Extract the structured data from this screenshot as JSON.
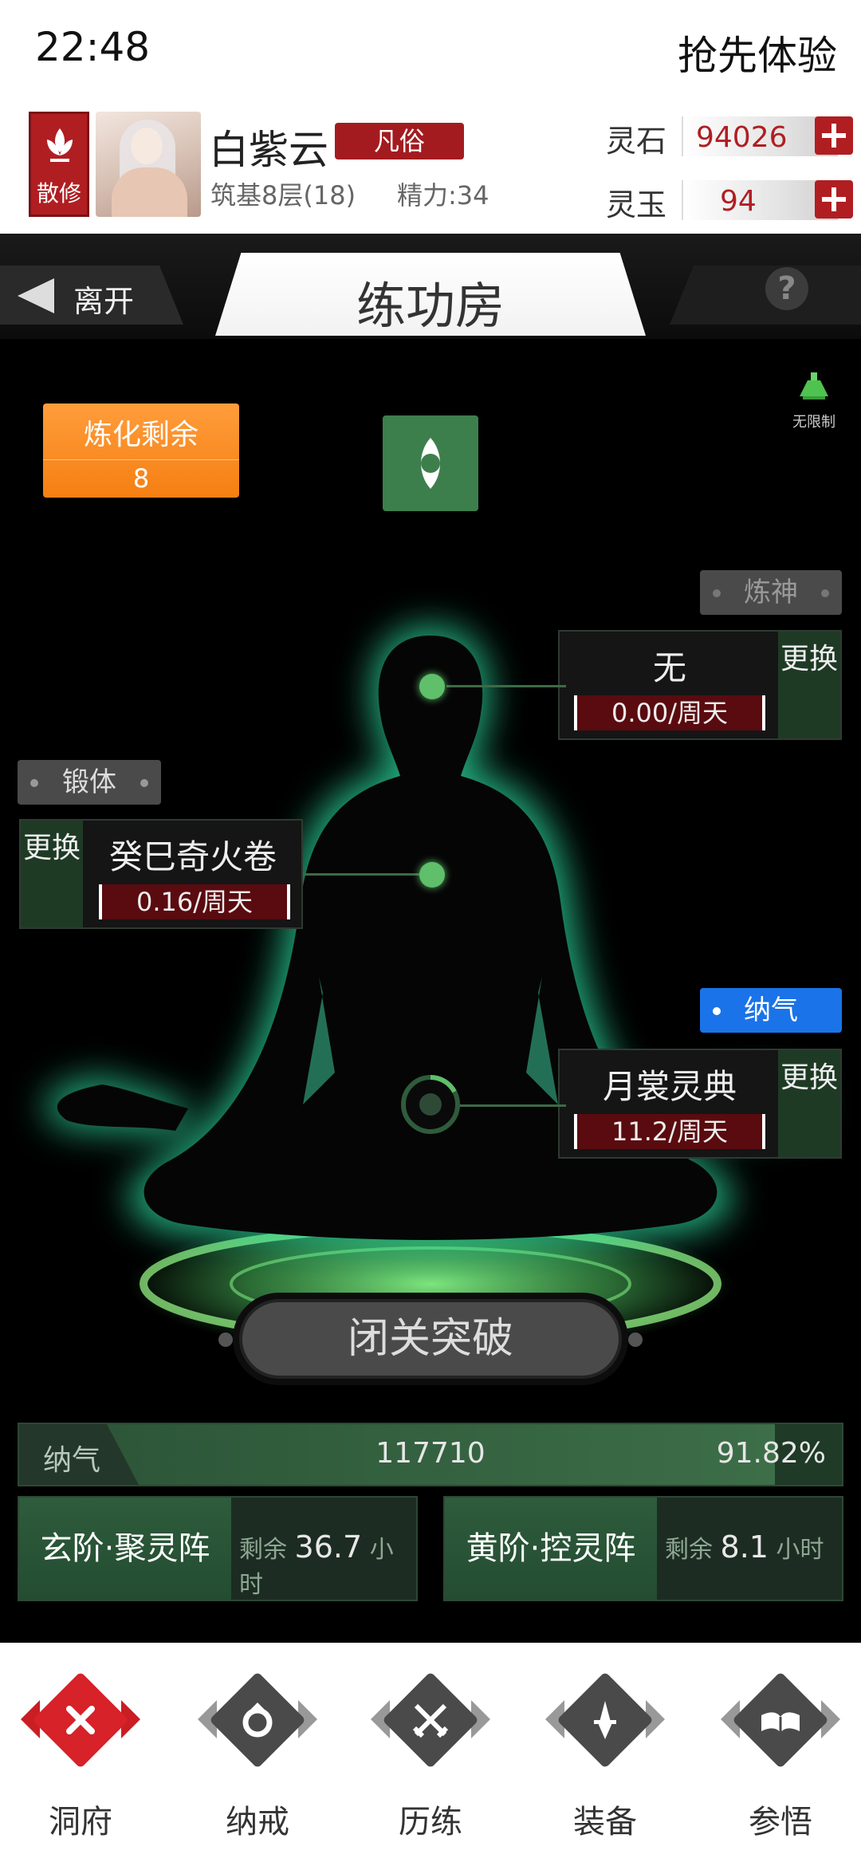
{
  "status_bar": {
    "time": "22:48",
    "right_text": "抢先体验"
  },
  "profile": {
    "sect": "散修",
    "name": "白紫云",
    "rank": "凡俗",
    "realm": "筑基8层(18)",
    "energy": "精力:34",
    "currencies": [
      {
        "label": "灵石",
        "value": "94026"
      },
      {
        "label": "灵玉",
        "value": "94"
      }
    ]
  },
  "header": {
    "leave": "离开",
    "title": "练功房",
    "help": "?"
  },
  "main": {
    "refine": {
      "label": "炼化剩余",
      "value": "8"
    },
    "unlimited": "无限制",
    "categories": {
      "spirit": "炼神",
      "body": "锻体",
      "qi": "纳气"
    },
    "cards": {
      "spirit": {
        "name": "无",
        "rate": "0.00/周天",
        "swap": "更换"
      },
      "body": {
        "name": "癸巳奇火卷",
        "rate": "0.16/周天",
        "swap": "更换"
      },
      "qi": {
        "name": "月裳灵典",
        "rate": "11.2/周天",
        "swap": "更换"
      }
    },
    "breakthrough": "闭关突破",
    "qi_bar": {
      "label": "纳气",
      "value": "117710",
      "percent": "91.82%",
      "fill": 0.9182
    },
    "arrays": [
      {
        "name": "玄阶·聚灵阵",
        "remaining_label": "剩余",
        "remaining": "36.7",
        "unit": "小时"
      },
      {
        "name": "黄阶·控灵阵",
        "remaining_label": "剩余",
        "remaining": "8.1",
        "unit": "小时"
      }
    ]
  },
  "bottom_nav": [
    {
      "label": "洞府",
      "icon": "close-icon",
      "active": true
    },
    {
      "label": "纳戒",
      "icon": "ring-icon"
    },
    {
      "label": "历练",
      "icon": "crossed-swords-icon"
    },
    {
      "label": "装备",
      "icon": "sword-icon"
    },
    {
      "label": "参悟",
      "icon": "book-icon"
    }
  ],
  "colors": {
    "accent_red": "#b01e22",
    "orange": "#f57f12",
    "jade_green": "#3d7f4c",
    "qi_blue": "#1a73e8"
  }
}
